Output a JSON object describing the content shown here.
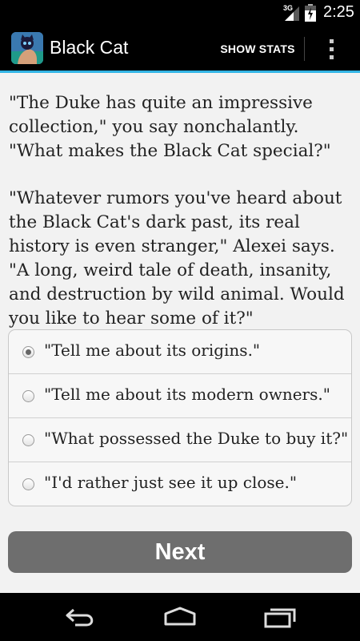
{
  "status_bar": {
    "network": "3G",
    "time": "2:25"
  },
  "action_bar": {
    "title": "Black Cat",
    "show_stats_label": "SHOW STATS",
    "app_icon": "black-cat-app-icon",
    "overflow_icon": "overflow-menu-icon"
  },
  "story": {
    "paragraphs": [
      "\"The Duke has quite an impressive collection,\" you say nonchalantly. \"What makes the Black Cat special?\"",
      "\"Whatever rumors you've heard about the Black Cat's dark past, its real history is even stranger,\" Alexei says. \"A long, weird tale of death, insanity, and destruction by wild animal. Would you like to hear some of it?\""
    ]
  },
  "choices": [
    {
      "label": "\"Tell me about its origins.\"",
      "selected": true
    },
    {
      "label": "\"Tell me about its modern owners.\"",
      "selected": false
    },
    {
      "label": "\"What possessed the Duke to buy it?\"",
      "selected": false
    },
    {
      "label": "\"I'd rather just see it up close.\"",
      "selected": false
    }
  ],
  "next_button": {
    "label": "Next"
  },
  "nav_bar": {
    "back_icon": "back-icon",
    "home_icon": "home-icon",
    "recents_icon": "recents-icon"
  },
  "colors": {
    "accent": "#33b5e5",
    "background": "#f2f2f2",
    "button": "#6e6e6e"
  }
}
